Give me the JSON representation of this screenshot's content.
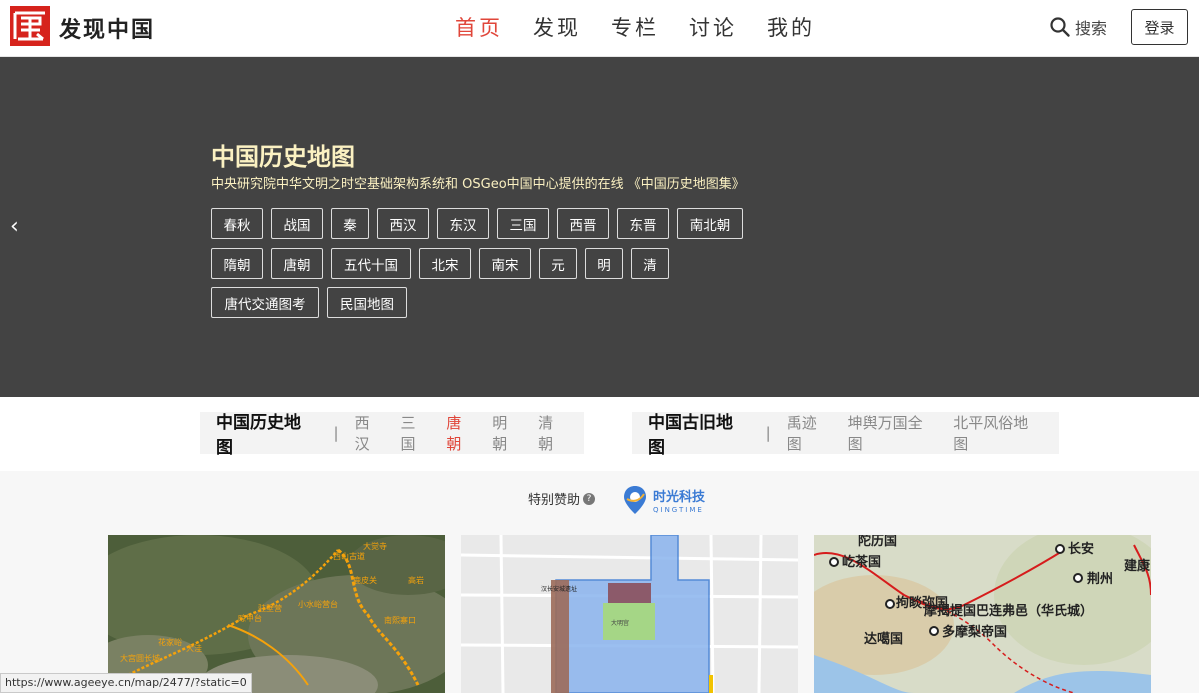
{
  "brand": {
    "name": "发现中国"
  },
  "nav": [
    {
      "label": "首页",
      "active": true
    },
    {
      "label": "发现",
      "active": false
    },
    {
      "label": "专栏",
      "active": false
    },
    {
      "label": "讨论",
      "active": false
    },
    {
      "label": "我的",
      "active": false
    }
  ],
  "header": {
    "search_label": "搜索",
    "login_label": "登录"
  },
  "hero": {
    "title": "中国历史地图",
    "subtitle": "中央研究院中华文明之时空基础架构系统和 OSGeo中国中心提供的在线 《中国历史地图集》",
    "prev_icon": "‹",
    "dynasties_row1": [
      "春秋",
      "战国",
      "秦",
      "西汉",
      "东汉",
      "三国",
      "西晋",
      "东晋",
      "南北朝"
    ],
    "dynasties_row2": [
      "隋朝",
      "唐朝",
      "五代十国",
      "北宋",
      "南宋",
      "元",
      "明",
      "清"
    ],
    "dynasties_row3": [
      "唐代交通图考",
      "民国地图"
    ]
  },
  "filters": {
    "history": {
      "title": "中国历史地图",
      "items": [
        "西汉",
        "三国",
        "唐朝",
        "明朝",
        "清朝"
      ],
      "active": "唐朝"
    },
    "ancient": {
      "title": "中国古旧地图",
      "items": [
        "禹迹图",
        "坤舆万国全图",
        "北平风俗地图"
      ]
    }
  },
  "sponsor": {
    "label": "特别赞助",
    "help_icon": "?",
    "name": "时光科技",
    "sub": "QINGTIME"
  },
  "cards": {
    "card1": {
      "labels": [
        "西山古道",
        "大觉寺",
        "小水峪营台",
        "花家峪",
        "大宫圆长城",
        "鹿皮关",
        "驻壁营",
        "高岩",
        "南熙寨口",
        "大洼",
        "晾甲台"
      ]
    },
    "card2": {
      "labels": [
        "汉长安城遗址",
        "大明宫"
      ]
    },
    "card3": {
      "labels": [
        "屹茶国",
        "长安",
        "荆州",
        "建康",
        "拘睒弥国",
        "摩揭提国巴连弗邑（华氏城）",
        "达噶国",
        "多摩梨帝国",
        "陀历国"
      ]
    }
  },
  "status_bar": {
    "url": "https://www.ageeye.cn/map/2477/?static=0"
  },
  "colors": {
    "accent": "#e0463a",
    "hero_bg": "#434343",
    "hero_text": "#fbf1c2",
    "logo_red": "#d6231c"
  }
}
